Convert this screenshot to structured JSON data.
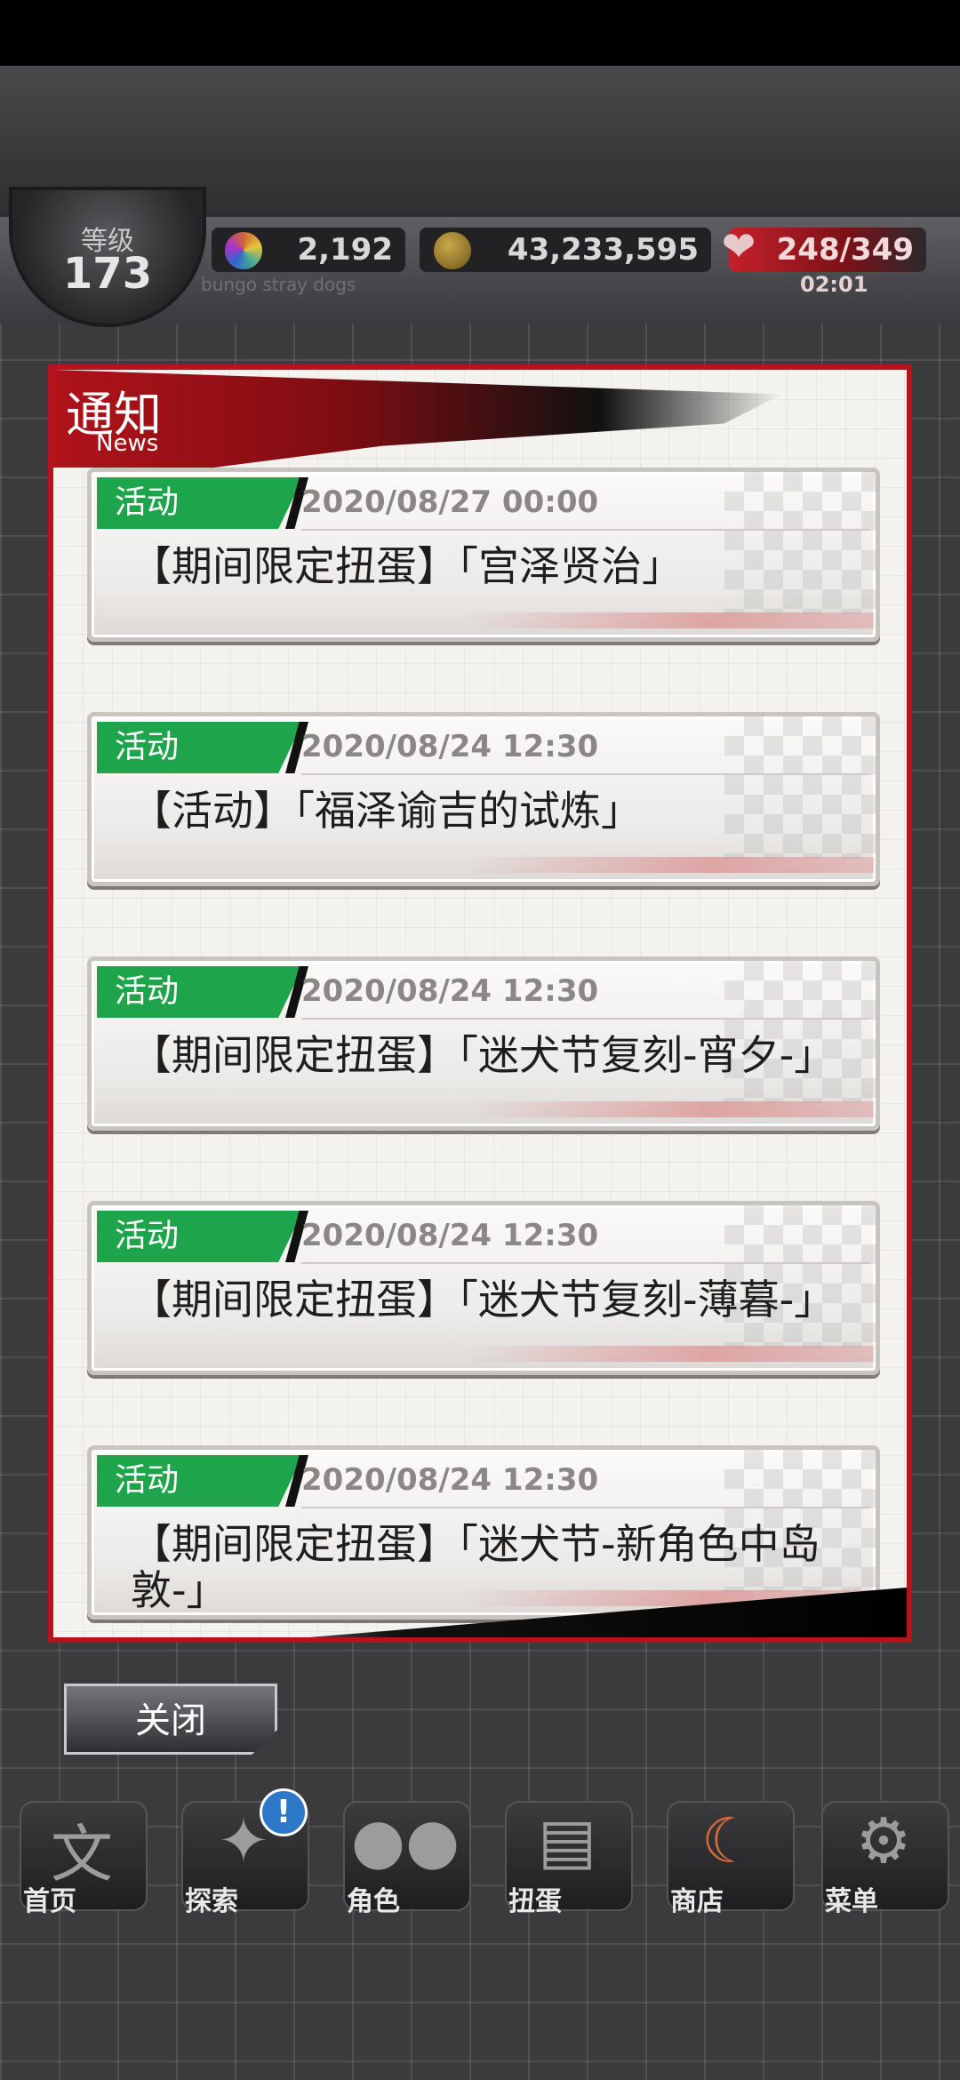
{
  "hud": {
    "level_label": "等级",
    "level_value": "173",
    "gems": "2,192",
    "gold": "43,233,595",
    "stamina": "248/349",
    "stamina_timer": "02:01",
    "subtitle": "bungo stray dogs"
  },
  "modal": {
    "title": "通知",
    "subtitle": "News",
    "items": [
      {
        "tag": "活动",
        "date": "2020/08/27 00:00",
        "title": "【期间限定扭蛋】「宫泽贤治」"
      },
      {
        "tag": "活动",
        "date": "2020/08/24 12:30",
        "title": "【活动】「福泽谕吉的试炼」"
      },
      {
        "tag": "活动",
        "date": "2020/08/24 12:30",
        "title": "【期间限定扭蛋】「迷犬节复刻-宵夕-」"
      },
      {
        "tag": "活动",
        "date": "2020/08/24 12:30",
        "title": "【期间限定扭蛋】「迷犬节复刻-薄暮-」"
      },
      {
        "tag": "活动",
        "date": "2020/08/24 12:30",
        "title": "【期间限定扭蛋】「迷犬节-新角色中岛敦-」"
      }
    ]
  },
  "close_button": "关闭",
  "nav": {
    "home": "首页",
    "explore": "探索",
    "characters": "角色",
    "gacha": "扭蛋",
    "shop": "商店",
    "menu": "菜单",
    "badge": "!"
  },
  "colors": {
    "accent_red": "#b4141a",
    "tag_green": "#1ea44a",
    "background": "#3b3b3e"
  },
  "icons": {
    "gem": "gem-icon",
    "gold": "gold-coin-icon",
    "stamina": "heart-icon",
    "home": "home-emblem-icon",
    "explore": "explore-icon",
    "characters": "characters-icon",
    "gacha": "gacha-book-icon",
    "shop": "shop-moon-icon",
    "menu": "gear-icon"
  }
}
